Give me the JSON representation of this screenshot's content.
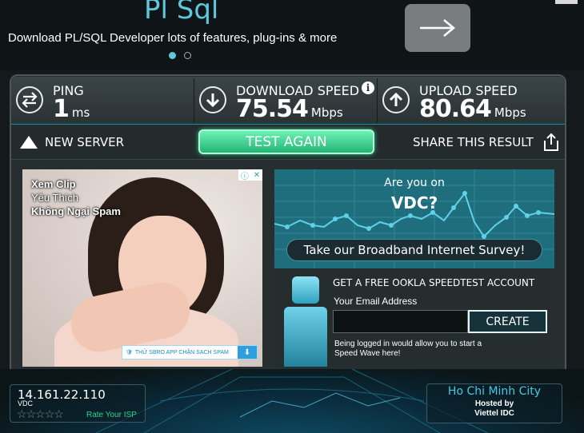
{
  "banner": {
    "title": "Pl Sql",
    "subtitle": "Download PL/SQL Developer lots of features, plug-ins & more"
  },
  "metrics": {
    "ping": {
      "label": "PING",
      "value": "1",
      "unit": "ms"
    },
    "download": {
      "label": "DOWNLOAD SPEED",
      "value": "75.54",
      "unit": "Mbps"
    },
    "upload": {
      "label": "UPLOAD SPEED",
      "value": "80.64",
      "unit": "Mbps"
    }
  },
  "actions": {
    "new_server": "NEW SERVER",
    "test_again": "TEST AGAIN",
    "share": "SHARE THIS RESULT"
  },
  "ad": {
    "line1": "Xem Clip",
    "line2": "Yêu Thích",
    "line3": "Không Ngại Spam",
    "strip": "THỬ SBRO APP CHẶN SẠCH SPAM"
  },
  "survey": {
    "question": "Are you on",
    "isp": "VDC?",
    "cta": "Take our Broadband Internet Survey!"
  },
  "account": {
    "title": "GET A FREE OOKLA SPEEDTEST ACCOUNT",
    "email_label": "Your Email Address",
    "email_value": "",
    "create": "CREATE",
    "note": "Being logged in would allow you to start a Speed Wave here!"
  },
  "server": {
    "ip": "14.161.22.110",
    "isp": "VDC",
    "rate": "Rate Your ISP"
  },
  "host": {
    "city": "Ho Chi Minh City",
    "hosted_by": "Hosted by",
    "name": "Viettel IDC"
  },
  "colors": {
    "accent": "#5ec8dc",
    "button_green": "#22b573",
    "survey_teal": "#1f6e7e"
  }
}
